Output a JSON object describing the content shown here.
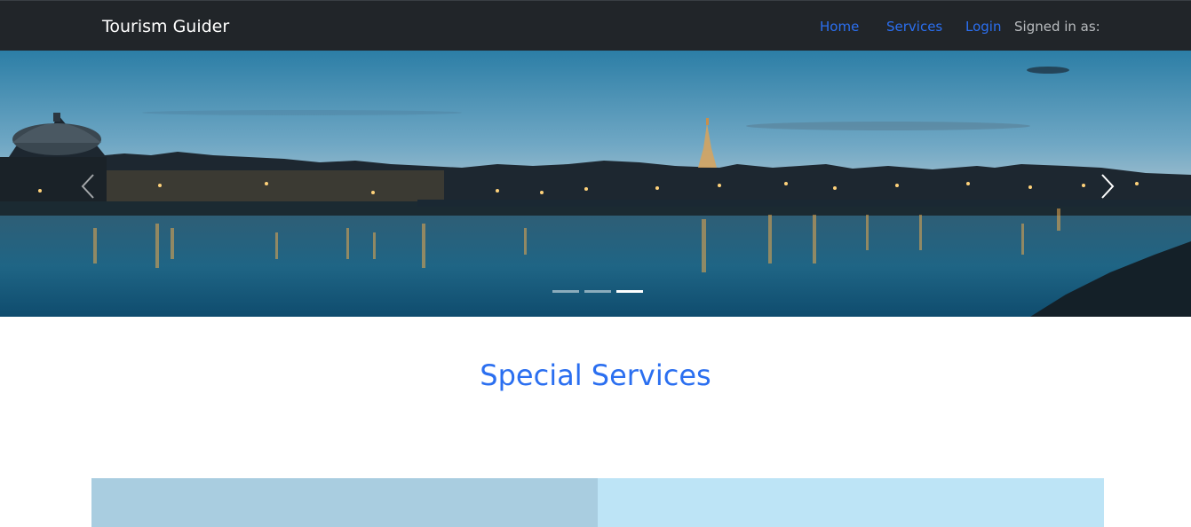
{
  "navbar": {
    "brand": "Tourism Guider",
    "links": [
      {
        "label": "Home"
      },
      {
        "label": "Services"
      },
      {
        "label": "Login"
      }
    ],
    "signed_in_text": "Signed in as:"
  },
  "carousel": {
    "slide_count": 3,
    "active_index": 2,
    "prev_icon": "chevron-left-icon",
    "next_icon": "chevron-right-icon"
  },
  "section": {
    "title": "Special Services"
  },
  "colors": {
    "navbar_bg": "#212529",
    "link": "#2b6ff0",
    "title": "#2b6ff0",
    "card_left": "#a9cde0",
    "card_right": "#bde4f6"
  }
}
